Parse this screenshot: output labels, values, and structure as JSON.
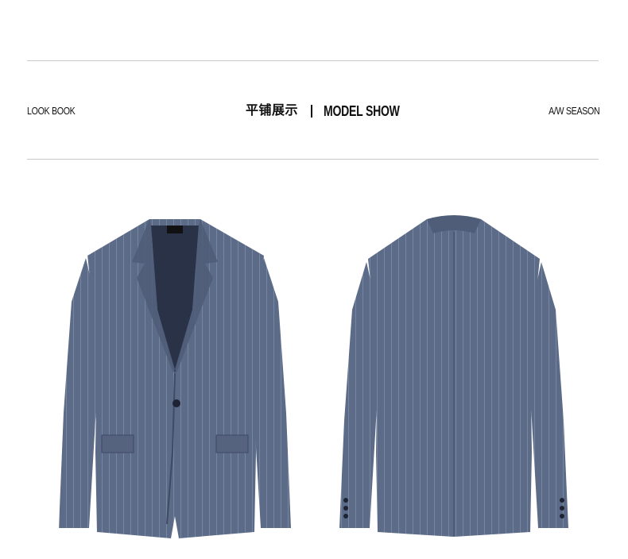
{
  "header": {
    "left_label": "LOOK BOOK",
    "center_cn": "平铺展示",
    "center_en": "MODEL SHOW",
    "right_label": "A/W SEASON"
  },
  "products": {
    "front": {
      "icon": "jacket-front-icon"
    },
    "back": {
      "icon": "jacket-back-icon"
    }
  },
  "colors": {
    "jacket": "#5c6b87",
    "jacket_dark": "#4a5672",
    "lining": "#2a3248",
    "stripe": "#8d9ab3",
    "rule": "#c9c9c9"
  }
}
